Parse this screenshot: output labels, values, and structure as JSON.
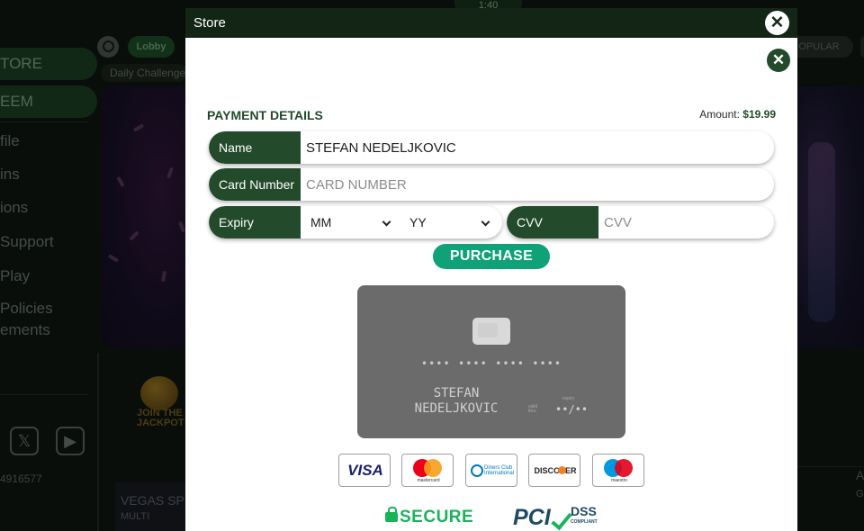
{
  "background": {
    "timer": "1:40",
    "nav": {
      "store_label": "TORE",
      "redeem_label": "EEM",
      "links": [
        "file",
        "ins",
        "ions",
        "Support",
        "Play",
        "Policies",
        "ements"
      ]
    },
    "phone": "4916577",
    "social": {
      "x_label": "𝕏",
      "youtube_label": "▶"
    },
    "pills": {
      "lobby": "Lobby",
      "popular": "OPULAR"
    },
    "daily_challenge": "Daily Challenge",
    "jackpot_text": "JOIN THE JACKPOT",
    "vegas": {
      "title": "VEGAS SP",
      "subtitle": "MULTI"
    },
    "edge_right": {
      "line1": "A",
      "line2": "G"
    }
  },
  "modal": {
    "title": "Store",
    "close_glyph": "✕",
    "inner_close_glyph": "✕",
    "payment_title": "PAYMENT DETAILS",
    "amount_label": "Amount:",
    "amount_value": "$19.99",
    "name": {
      "label": "Name",
      "value": "STEFAN NEDELJKOVIC"
    },
    "card_number": {
      "label": "Card Number",
      "placeholder": "CARD NUMBER"
    },
    "expiry": {
      "label": "Expiry",
      "month": "MM",
      "year": "YY"
    },
    "cvv": {
      "label": "CVV",
      "placeholder": "CVV"
    },
    "purchase_label": "PURCHASE"
  },
  "card_preview": {
    "number_mask": "•••• •••• •••• ••••",
    "holder": "STEFAN NEDELJKOVIC",
    "valid_thru": "valid thru",
    "expiry_label": "expiry",
    "expiry_mask": "••/••"
  },
  "payment_brands": {
    "visa": "VISA",
    "mastercard": "mastercard",
    "diners": "Diners Club International",
    "discover": "DISCOVER",
    "maestro": "maestro"
  },
  "badges": {
    "secure": "SECURE",
    "pci": "PCI",
    "dss": "DSS",
    "compliant": "COMPLIANT"
  },
  "colors": {
    "brand_green": "#234a2b",
    "purchase_teal": "#0fa177",
    "header_dark": "#132616",
    "secure_green": "#19b35a"
  }
}
